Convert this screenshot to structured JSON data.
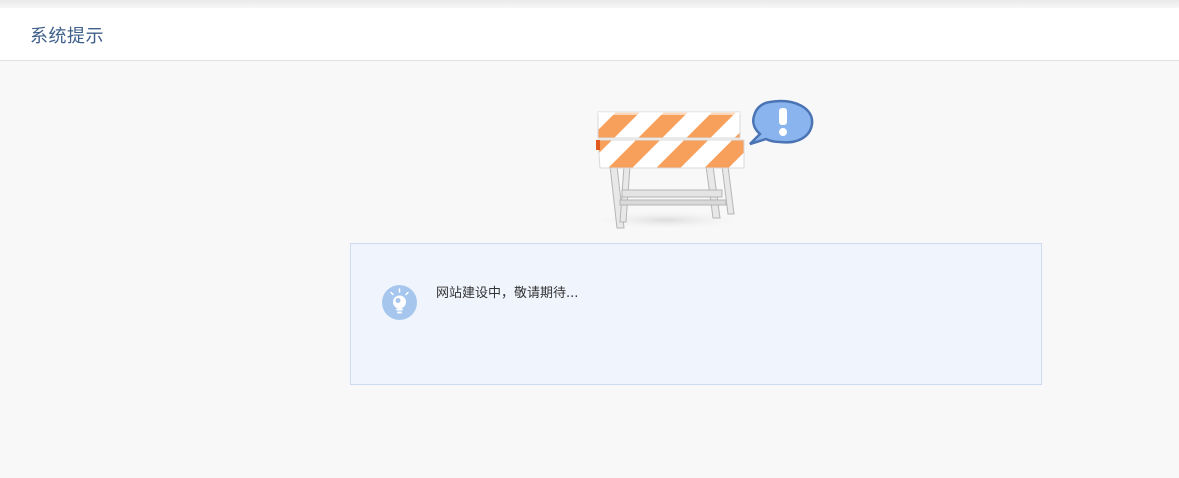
{
  "header": {
    "title": "系统提示"
  },
  "notice": {
    "message": "网站建设中，敬请期待...",
    "icon": "lightbulb-icon"
  },
  "illustration": {
    "icon": "road-barrier-with-exclamation-bubble"
  },
  "colors": {
    "title": "#3f5f8a",
    "background": "#f8f8f8",
    "notice_bg": "#f0f5fd",
    "notice_border": "#cddcf2",
    "barrier_orange": "#f7a05c",
    "bubble_blue": "#7aa6e6",
    "bulb_blue": "#a6c6ee"
  }
}
